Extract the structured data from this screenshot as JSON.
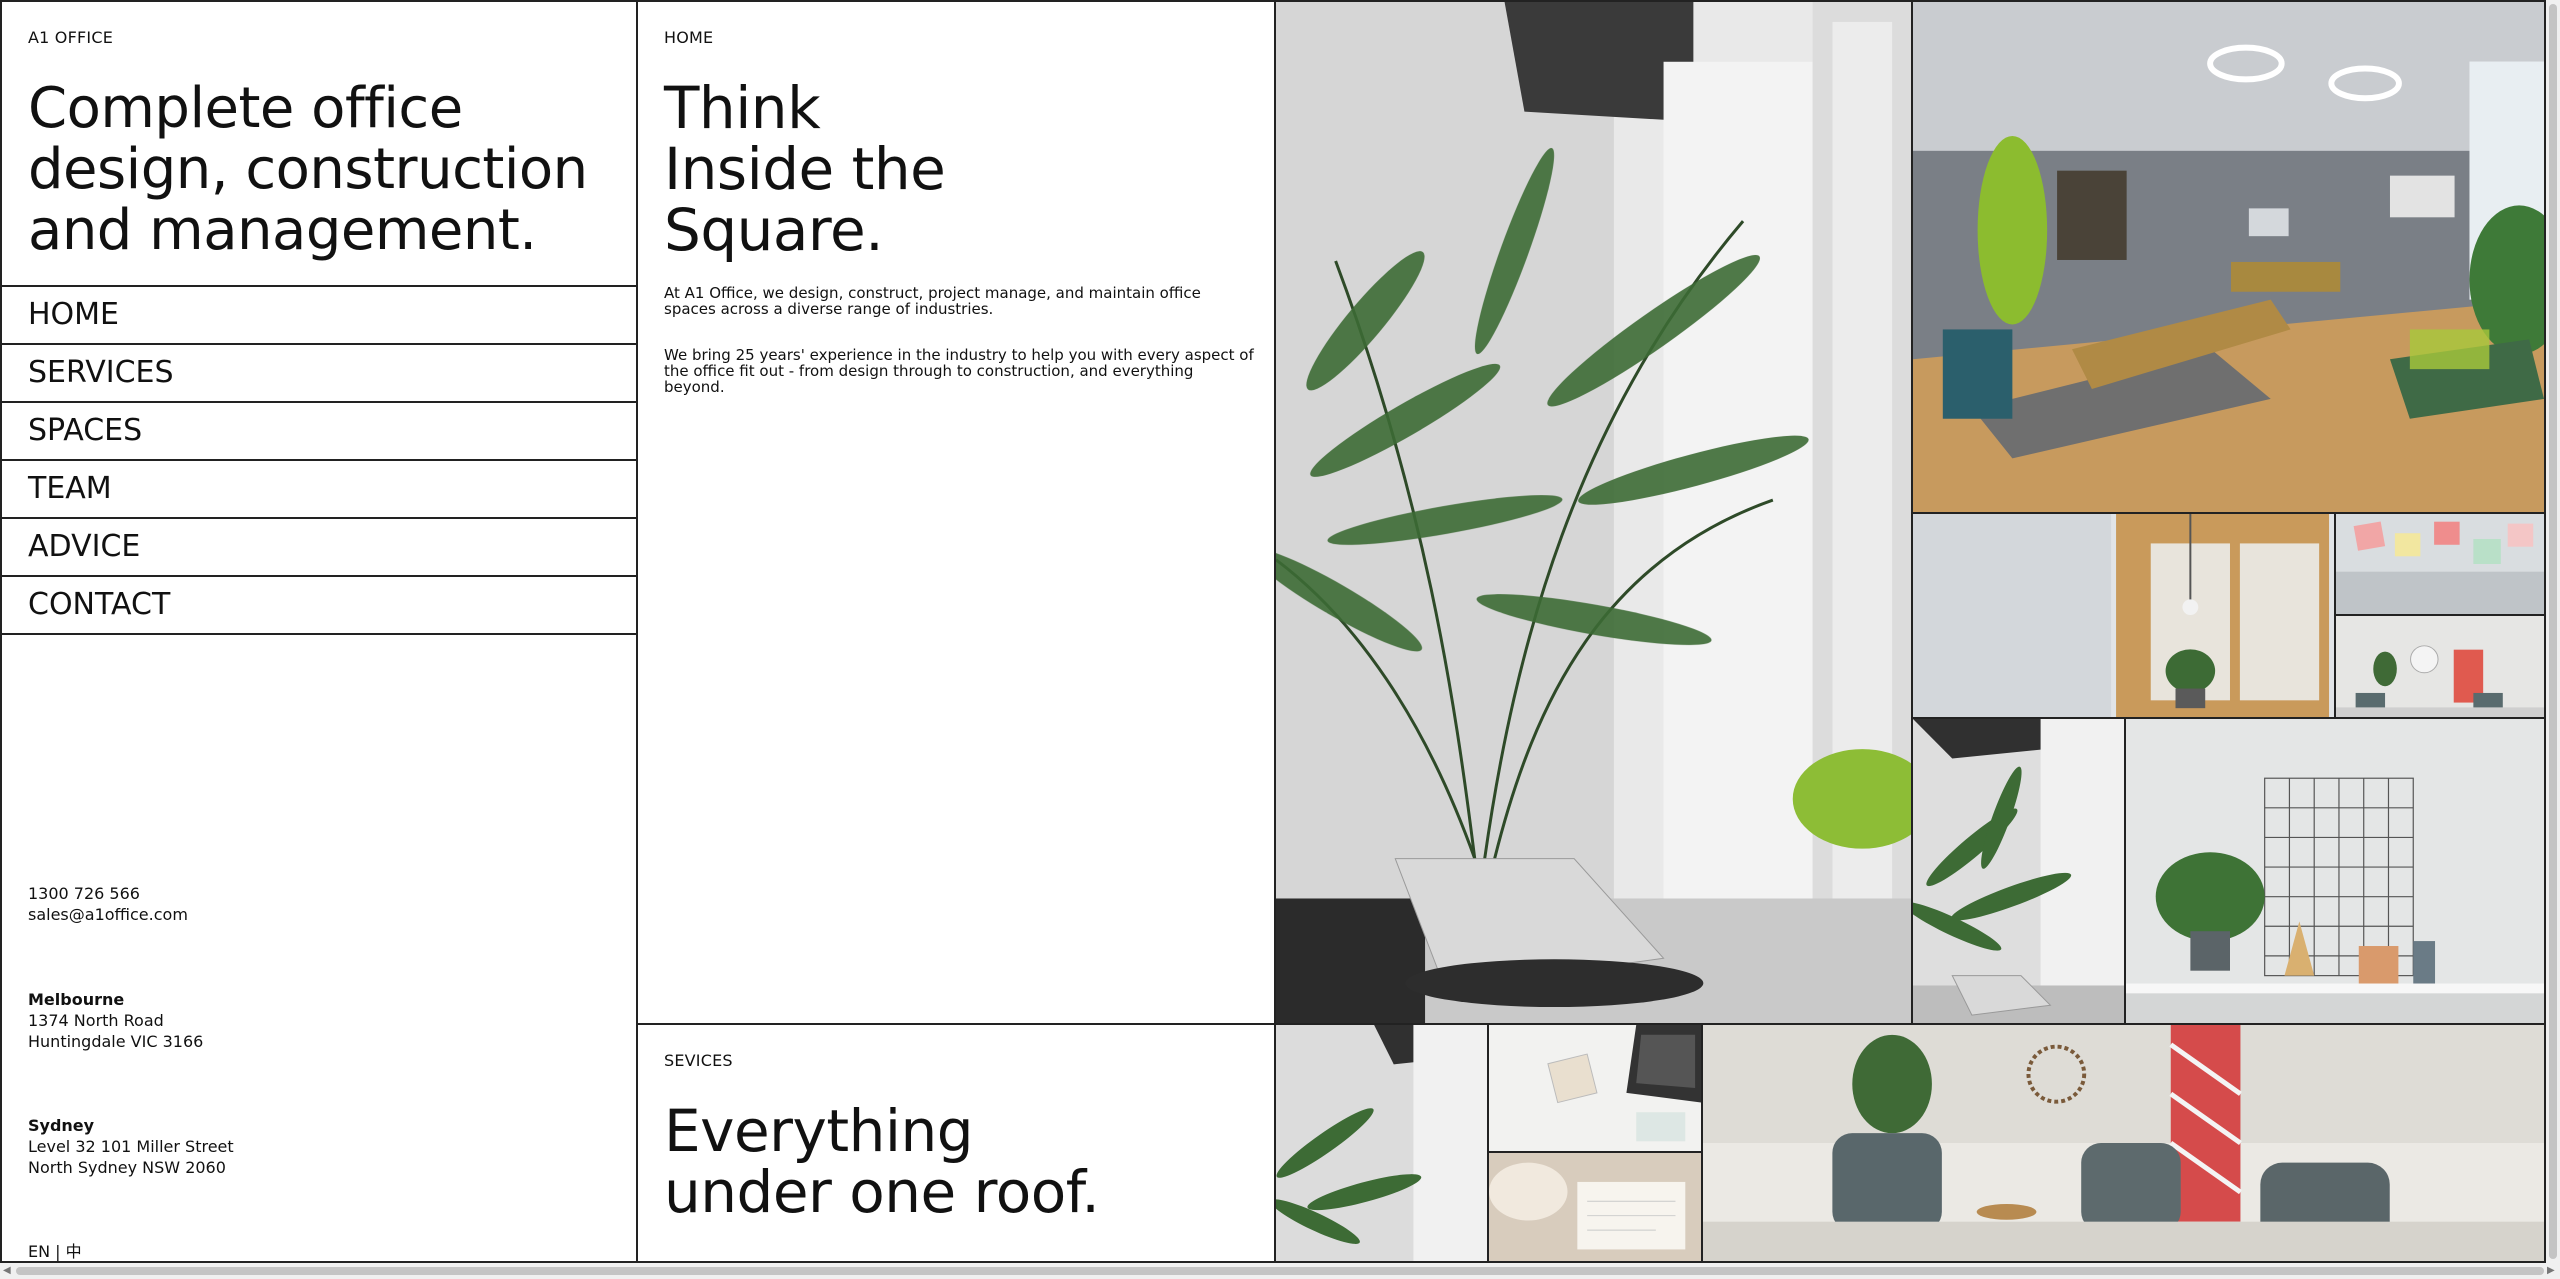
{
  "brand": "A1 OFFICE",
  "tagline": "Complete office design, construction and management.",
  "nav": [
    {
      "label": "HOME"
    },
    {
      "label": "SERVICES"
    },
    {
      "label": "SPACES"
    },
    {
      "label": "TEAM"
    },
    {
      "label": "ADVICE"
    },
    {
      "label": "CONTACT"
    }
  ],
  "contact": {
    "phone": "1300 726 566",
    "email": "sales@a1office.com"
  },
  "offices": [
    {
      "city": "Melbourne",
      "line1": "1374 North Road",
      "line2": "Huntingdale VIC 3166"
    },
    {
      "city": "Sydney",
      "line1": "Level 32 101 Miller Street",
      "line2": "North Sydney NSW 2060"
    }
  ],
  "language": {
    "en": "EN",
    "separator": "|",
    "zh": "中"
  },
  "home_section": {
    "eyebrow": "HOME",
    "headline_lines": [
      "Think",
      "Inside the",
      "Square."
    ],
    "paragraph1": "At A1 Office, we design, construct, project manage, and maintain office spaces across a diverse range of industries.",
    "paragraph2": "We bring 25 years' experience in the industry to help you with every aspect of the office fit out - from design through to construction, and everything beyond."
  },
  "services_section": {
    "eyebrow": "SEVICES",
    "headline_lines": [
      "Everything",
      "under one roof."
    ]
  },
  "colors": {
    "border": "#222222",
    "text": "#111111",
    "background": "#ffffff",
    "plant_green": "#2f5a2a",
    "accent_lime": "#9ac93a",
    "wood": "#c99a5b"
  }
}
